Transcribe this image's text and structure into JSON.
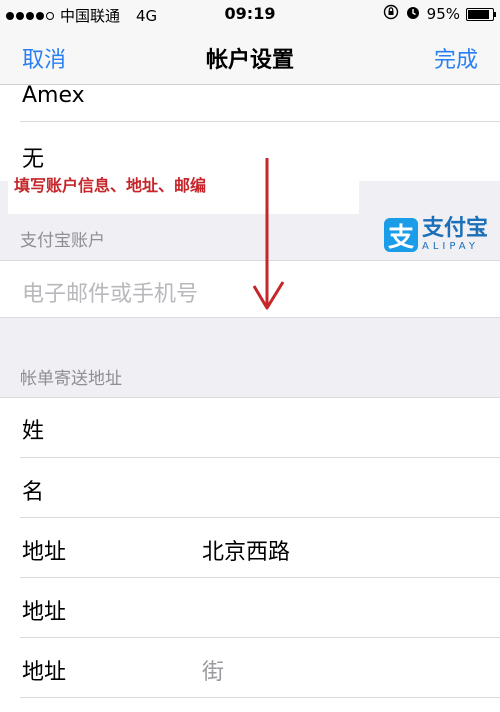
{
  "status": {
    "carrier": "中国联通",
    "network": "4G",
    "time": "09:19",
    "battery": "95%",
    "battery_level": 0.95
  },
  "nav": {
    "cancel": "取消",
    "title": "帐户设置",
    "done": "完成"
  },
  "card_rows": [
    {
      "label": "Amex"
    },
    {
      "label": "无"
    }
  ],
  "annotation": "填写账户信息、地址、邮编",
  "alipay_section": {
    "header": "支付宝账户",
    "input_placeholder": "电子邮件或手机号"
  },
  "alipay_logo": {
    "icon": "支",
    "cn": "支付宝",
    "en": "ALIPAY",
    "color": "#1a9ce8"
  },
  "billing": {
    "header": "帐单寄送地址",
    "rows": [
      {
        "label": "姓",
        "value": ""
      },
      {
        "label": "名",
        "value": ""
      },
      {
        "label": "地址",
        "value": "北京西路"
      },
      {
        "label": "地址",
        "value": ""
      },
      {
        "label": "地址",
        "value": "街"
      }
    ]
  },
  "colors": {
    "accent": "#2a80f2",
    "annotation": "#c6252a"
  }
}
